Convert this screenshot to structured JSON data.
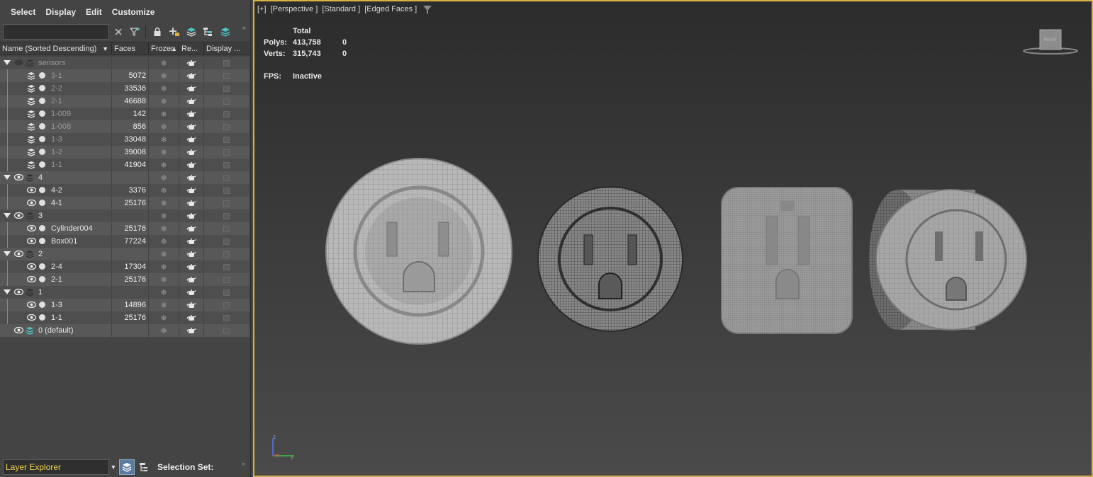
{
  "menu": [
    "Select",
    "Display",
    "Edit",
    "Customize"
  ],
  "search": {
    "value": "",
    "placeholder": ""
  },
  "columns": {
    "name": "Name (Sorted Descending)",
    "faces": "Faces",
    "frozen": "Frozen",
    "render": "Re...",
    "display": "Display ..."
  },
  "rows": [
    {
      "label": "sensors",
      "faces": "",
      "level": 0,
      "type": "layer",
      "hidden": true,
      "dim": true
    },
    {
      "label": "3-1",
      "faces": "5072",
      "level": 1,
      "type": "object",
      "hidden": true,
      "dim": true
    },
    {
      "label": "2-2",
      "faces": "33536",
      "level": 1,
      "type": "object",
      "hidden": true,
      "dim": true
    },
    {
      "label": "2-1",
      "faces": "46688",
      "level": 1,
      "type": "object",
      "hidden": true,
      "dim": true
    },
    {
      "label": "1-009",
      "faces": "142",
      "level": 1,
      "type": "object",
      "hidden": true,
      "dim": true
    },
    {
      "label": "1-008",
      "faces": "856",
      "level": 1,
      "type": "object",
      "hidden": true,
      "dim": true
    },
    {
      "label": "1-3",
      "faces": "33048",
      "level": 1,
      "type": "object",
      "hidden": true,
      "dim": true
    },
    {
      "label": "1-2",
      "faces": "39008",
      "level": 1,
      "type": "object",
      "hidden": true,
      "dim": true
    },
    {
      "label": "1-1",
      "faces": "41904",
      "level": 1,
      "type": "object",
      "hidden": true,
      "dim": true
    },
    {
      "label": "4",
      "faces": "",
      "level": 0,
      "type": "layer",
      "hidden": false,
      "dim": false
    },
    {
      "label": "4-2",
      "faces": "3376",
      "level": 1,
      "type": "object",
      "hidden": false,
      "dim": false
    },
    {
      "label": "4-1",
      "faces": "25176",
      "level": 1,
      "type": "object",
      "hidden": false,
      "dim": false
    },
    {
      "label": "3",
      "faces": "",
      "level": 0,
      "type": "layer",
      "hidden": false,
      "dim": false
    },
    {
      "label": "Cylinder004",
      "faces": "25176",
      "level": 1,
      "type": "object",
      "hidden": false,
      "dim": false
    },
    {
      "label": "Box001",
      "faces": "77224",
      "level": 1,
      "type": "object",
      "hidden": false,
      "dim": false
    },
    {
      "label": "2",
      "faces": "",
      "level": 0,
      "type": "layer",
      "hidden": false,
      "dim": false
    },
    {
      "label": "2-4",
      "faces": "17304",
      "level": 1,
      "type": "object",
      "hidden": false,
      "dim": false
    },
    {
      "label": "2-1",
      "faces": "25176",
      "level": 1,
      "type": "object",
      "hidden": false,
      "dim": false
    },
    {
      "label": "1",
      "faces": "",
      "level": 0,
      "type": "layer",
      "hidden": false,
      "dim": false
    },
    {
      "label": "1-3",
      "faces": "14896",
      "level": 1,
      "type": "object",
      "hidden": false,
      "dim": false
    },
    {
      "label": "1-1",
      "faces": "25176",
      "level": 1,
      "type": "object",
      "hidden": false,
      "dim": false
    },
    {
      "label": "0 (default)",
      "faces": "",
      "level": 0,
      "type": "default",
      "hidden": false,
      "dim": false
    }
  ],
  "bottom": {
    "explorer": "Layer Explorer",
    "selection_set": "Selection Set:"
  },
  "viewport": {
    "labels": [
      "[+]",
      "[Perspective ]",
      "[Standard ]",
      "[Edged Faces ]"
    ],
    "stats": {
      "total_label": "Total",
      "polys_label": "Polys:",
      "polys": "413,758",
      "polys_sel": "0",
      "verts_label": "Verts:",
      "verts": "315,743",
      "verts_sel": "0",
      "fps_label": "FPS:",
      "fps": "Inactive"
    },
    "viewcube_label": "RIGHT",
    "axis": {
      "z": "z",
      "x": "x",
      "y": "y"
    }
  },
  "colors": {
    "viewport_border": "#d8b046",
    "explorer_text": "#f2d34b",
    "accent_layer": "#4fc3c3"
  }
}
